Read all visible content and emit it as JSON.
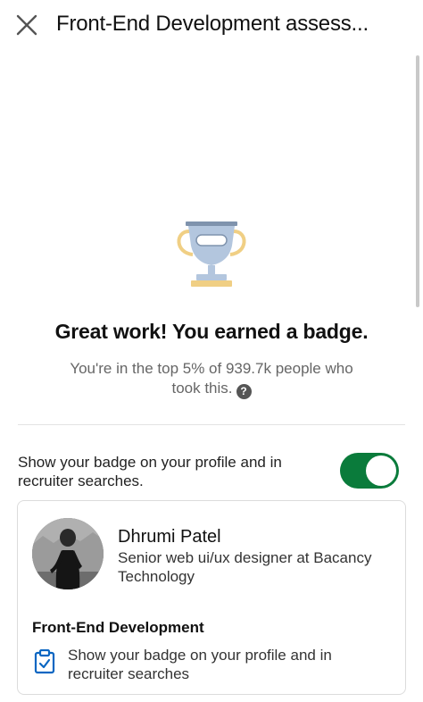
{
  "header": {
    "title": "Front-End Development assess..."
  },
  "result": {
    "headline": "Great work! You earned a badge.",
    "subtext": "You're in the top 5% of 939.7k people who took this.",
    "help_icon": "?"
  },
  "badge_toggle": {
    "label": "Show your badge on your profile and in recruiter searches.",
    "state": "on"
  },
  "preview_card": {
    "name": "Dhrumi Patel",
    "headline": "Senior web ui/ux designer at Bacancy Technology",
    "skill_title": "Front-End Development",
    "skill_text": "Show your badge on your profile and in recruiter searches"
  },
  "colors": {
    "toggle_on": "#0a7b3b",
    "trophy_silver": "#b3c6de",
    "trophy_gold": "#f0cf84",
    "icon_blue": "#0a66c2"
  }
}
